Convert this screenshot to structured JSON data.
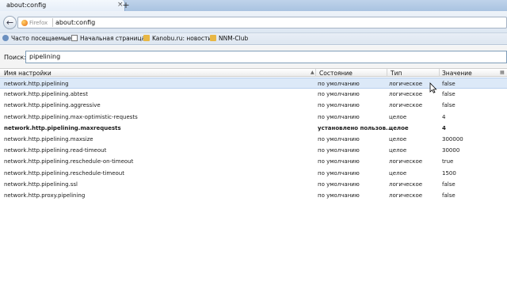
{
  "tab": {
    "title": "about:config"
  },
  "nav": {
    "identity_label": "Firefox",
    "url": "about:config"
  },
  "bookmarks": [
    {
      "label": "Часто посещаемые",
      "icon": "gear-icon"
    },
    {
      "label": "Начальная страница",
      "icon": "page-icon"
    },
    {
      "label": "Kanobu.ru: новости",
      "icon": "folder-icon"
    },
    {
      "label": "NNM-Club",
      "icon": "folder-icon"
    }
  ],
  "search": {
    "label": "Поиск:",
    "value": "pipelining"
  },
  "columns": {
    "name": "Имя настройки",
    "status": "Состояние",
    "type": "Тип",
    "value": "Значение"
  },
  "rows": [
    {
      "name": "network.http.pipelining",
      "status": "по умолчанию",
      "type": "логическое",
      "value": "false"
    },
    {
      "name": "network.http.pipelining.abtest",
      "status": "по умолчанию",
      "type": "логическое",
      "value": "false"
    },
    {
      "name": "network.http.pipelining.aggressive",
      "status": "по умолчанию",
      "type": "логическое",
      "value": "false"
    },
    {
      "name": "network.http.pipelining.max-optimistic-requests",
      "status": "по умолчанию",
      "type": "целое",
      "value": "4"
    },
    {
      "name": "network.http.pipelining.maxrequests",
      "status": "установлено пользов...",
      "type": "целое",
      "value": "4"
    },
    {
      "name": "network.http.pipelining.maxsize",
      "status": "по умолчанию",
      "type": "целое",
      "value": "300000"
    },
    {
      "name": "network.http.pipelining.read-timeout",
      "status": "по умолчанию",
      "type": "целое",
      "value": "30000"
    },
    {
      "name": "network.http.pipelining.reschedule-on-timeout",
      "status": "по умолчанию",
      "type": "логическое",
      "value": "true"
    },
    {
      "name": "network.http.pipelining.reschedule-timeout",
      "status": "по умолчанию",
      "type": "целое",
      "value": "1500"
    },
    {
      "name": "network.http.pipelining.ssl",
      "status": "по умолчанию",
      "type": "логическое",
      "value": "false"
    },
    {
      "name": "network.http.proxy.pipelining",
      "status": "по умолчанию",
      "type": "логическое",
      "value": "false"
    }
  ],
  "selected_row": 0,
  "modified_row": 4
}
